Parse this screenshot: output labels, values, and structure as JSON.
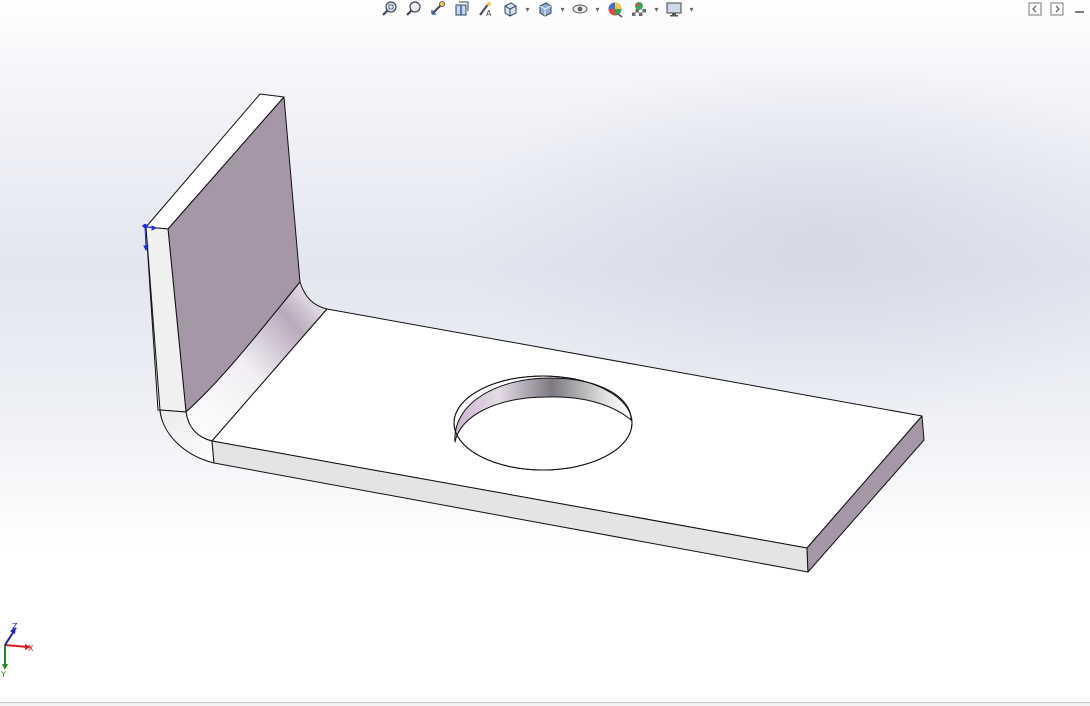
{
  "viewport": {
    "background_colors": {
      "top": "#ffffff",
      "mid": "#e3e6ef",
      "bottom": "#ffffff"
    }
  },
  "heads_up_toolbar": {
    "items": [
      {
        "name": "zoom-to-fit",
        "icon": "zoom-to-fit-icon"
      },
      {
        "name": "zoom-to-area",
        "icon": "zoom-to-area-icon"
      },
      {
        "name": "previous-view",
        "icon": "previous-view-icon"
      },
      {
        "name": "section-view",
        "icon": "section-view-icon"
      },
      {
        "name": "dynamic-annotation-views",
        "icon": "dynamic-annotation-icon"
      },
      {
        "name": "view-orientation",
        "icon": "view-orientation-icon",
        "dropdown": true
      },
      {
        "name": "display-style",
        "icon": "display-style-icon",
        "dropdown": true
      },
      {
        "name": "hide-show-items",
        "icon": "eye-icon",
        "dropdown": true
      },
      {
        "name": "edit-appearance",
        "icon": "appearance-icon"
      },
      {
        "name": "apply-scene",
        "icon": "scene-icon",
        "dropdown": true
      },
      {
        "name": "view-settings",
        "icon": "monitor-icon",
        "dropdown": true
      }
    ]
  },
  "window_controls": [
    {
      "name": "collapse-left",
      "icon": "collapse-left-icon"
    },
    {
      "name": "collapse-right",
      "icon": "collapse-right-icon"
    },
    {
      "name": "minimize",
      "icon": "minimize-icon"
    }
  ],
  "triad": {
    "x_label": "X",
    "y_label": "Y",
    "z_label": "Z",
    "colors": {
      "x": "#d21e1e",
      "y": "#1e8c1e",
      "z": "#1e1eb4"
    }
  },
  "model": {
    "type": "sheet-metal L-bracket with hole",
    "colors": {
      "face_light": "#ffffff",
      "face_side": "#e6e6e6",
      "face_shaded": "#a597a8",
      "edge": "#000000"
    }
  }
}
